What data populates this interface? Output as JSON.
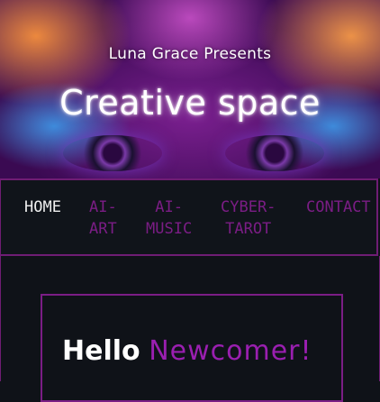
{
  "hero": {
    "presenter": "Luna Grace Presents",
    "title": "Creative space"
  },
  "nav": {
    "items": [
      {
        "label": "HOME",
        "active": true
      },
      {
        "label": "AI-\nART",
        "active": false
      },
      {
        "label": "AI-\nMUSIC",
        "active": false
      },
      {
        "label": "CYBER-\nTAROT",
        "active": false
      },
      {
        "label": "CONTACT",
        "active": false
      }
    ]
  },
  "welcome": {
    "hello": "Hello",
    "name": "Newcomer!"
  },
  "colors": {
    "background": "#0f1218",
    "accent": "#7b1d85",
    "active_text": "#f0f0f0"
  }
}
